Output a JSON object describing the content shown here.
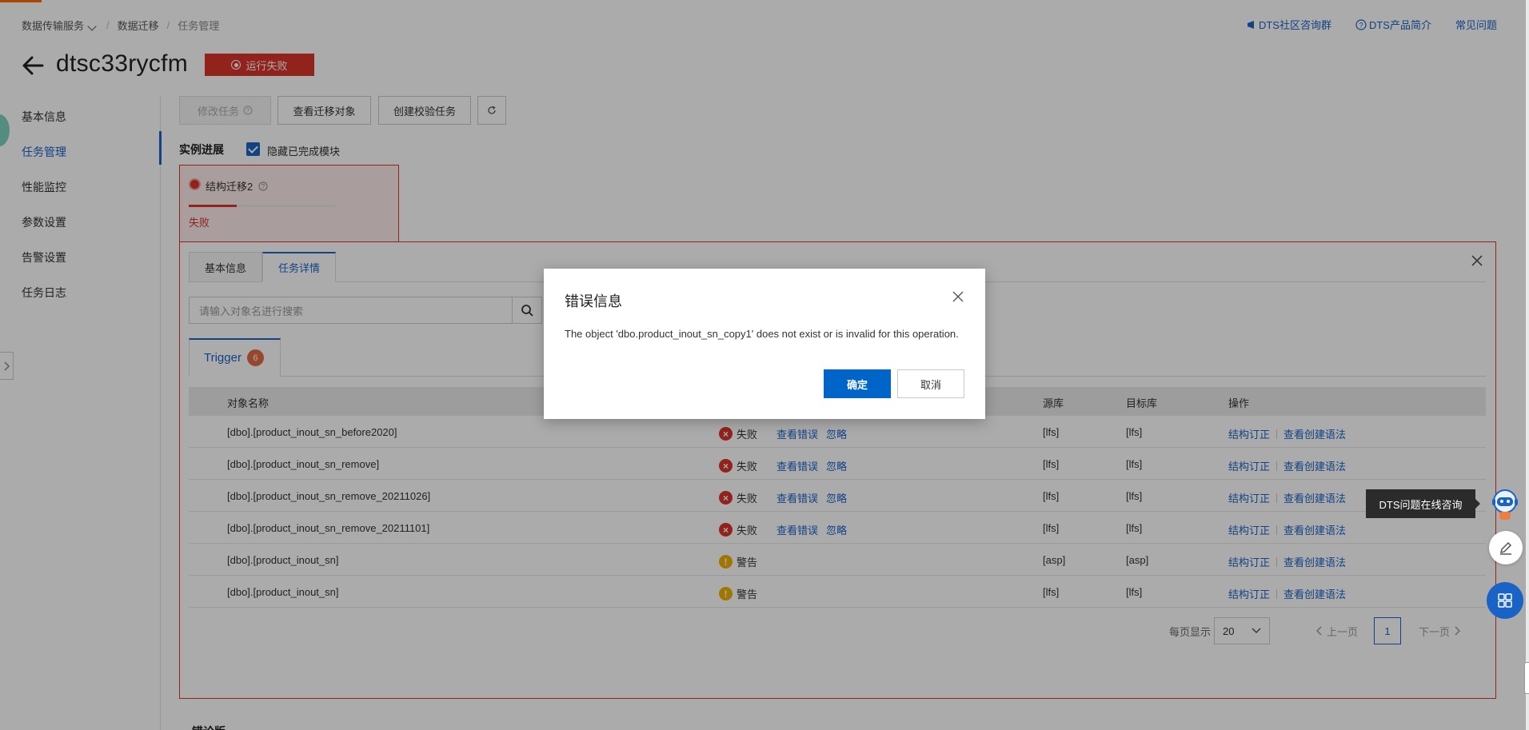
{
  "breadcrumb": {
    "service": "数据传输服务",
    "section": "数据迁移",
    "current": "任务管理"
  },
  "toplinks": {
    "community": "DTS社区咨询群",
    "product": "DTS产品简介",
    "faq": "常见问题"
  },
  "header": {
    "title": "dtsc33rycfm",
    "status": "运行失败"
  },
  "sidebar": {
    "items": [
      {
        "label": "基本信息"
      },
      {
        "label": "任务管理"
      },
      {
        "label": "性能监控"
      },
      {
        "label": "参数设置"
      },
      {
        "label": "告警设置"
      },
      {
        "label": "任务日志"
      }
    ],
    "active_index": 1
  },
  "toolbar": {
    "modify": "修改任务",
    "view_objects": "查看迁移对象",
    "create_check": "创建校验任务"
  },
  "progress": {
    "label": "实例进展",
    "hide_completed": "隐藏已完成模块"
  },
  "module": {
    "name": "结构迁移2",
    "status": "失败",
    "progress_fraction": 0.33
  },
  "detail": {
    "tabs": [
      {
        "label": "基本信息"
      },
      {
        "label": "任务详情"
      }
    ],
    "active_tab": 1,
    "search_placeholder": "请输入对象名进行搜索",
    "trigger_tab": {
      "label": "Trigger",
      "count": "6"
    },
    "columns": {
      "name": "对象名称",
      "source": "源库",
      "target": "目标库",
      "ops": "操作"
    },
    "rows": [
      {
        "name": "[dbo].[product_inout_sn_before2020]",
        "status": "失败",
        "type": "error",
        "view_error": "查看错误",
        "ignore": "忽略",
        "source": "[lfs]",
        "target": "[lfs]",
        "op1": "结构订正",
        "op2": "查看创建语法"
      },
      {
        "name": "[dbo].[product_inout_sn_remove]",
        "status": "失败",
        "type": "error",
        "view_error": "查看错误",
        "ignore": "忽略",
        "source": "[lfs]",
        "target": "[lfs]",
        "op1": "结构订正",
        "op2": "查看创建语法"
      },
      {
        "name": "[dbo].[product_inout_sn_remove_20211026]",
        "status": "失败",
        "type": "error",
        "view_error": "查看错误",
        "ignore": "忽略",
        "source": "[lfs]",
        "target": "[lfs]",
        "op1": "结构订正",
        "op2": "查看创建语法"
      },
      {
        "name": "[dbo].[product_inout_sn_remove_20211101]",
        "status": "失败",
        "type": "error",
        "view_error": "查看错误",
        "ignore": "忽略",
        "source": "[lfs]",
        "target": "[lfs]",
        "op1": "结构订正",
        "op2": "查看创建语法"
      },
      {
        "name": "[dbo].[product_inout_sn]",
        "status": "警告",
        "type": "warn",
        "view_error": "",
        "ignore": "",
        "source": "[asp]",
        "target": "[asp]",
        "op1": "结构订正",
        "op2": "查看创建语法"
      },
      {
        "name": "[dbo].[product_inout_sn]",
        "status": "警告",
        "type": "warn",
        "view_error": "",
        "ignore": "",
        "source": "[lfs]",
        "target": "[lfs]",
        "op1": "结构订正",
        "op2": "查看创建语法"
      }
    ],
    "pagination": {
      "per_page_label": "每页显示",
      "per_page": "20",
      "prev": "上一页",
      "page": "1",
      "next": "下一页"
    }
  },
  "bottom_text": "错论版",
  "modal": {
    "title": "错误信息",
    "message": "The object 'dbo.product_inout_sn_copy1' does not exist or is invalid for this operation.",
    "ok": "确定",
    "cancel": "取消"
  },
  "assistant": {
    "tooltip": "DTS问题在线咨询"
  },
  "colors": {
    "accent": "#1a63c6",
    "error": "#d9342b",
    "warn": "#f1b100",
    "primary_button": "#0064c8"
  }
}
